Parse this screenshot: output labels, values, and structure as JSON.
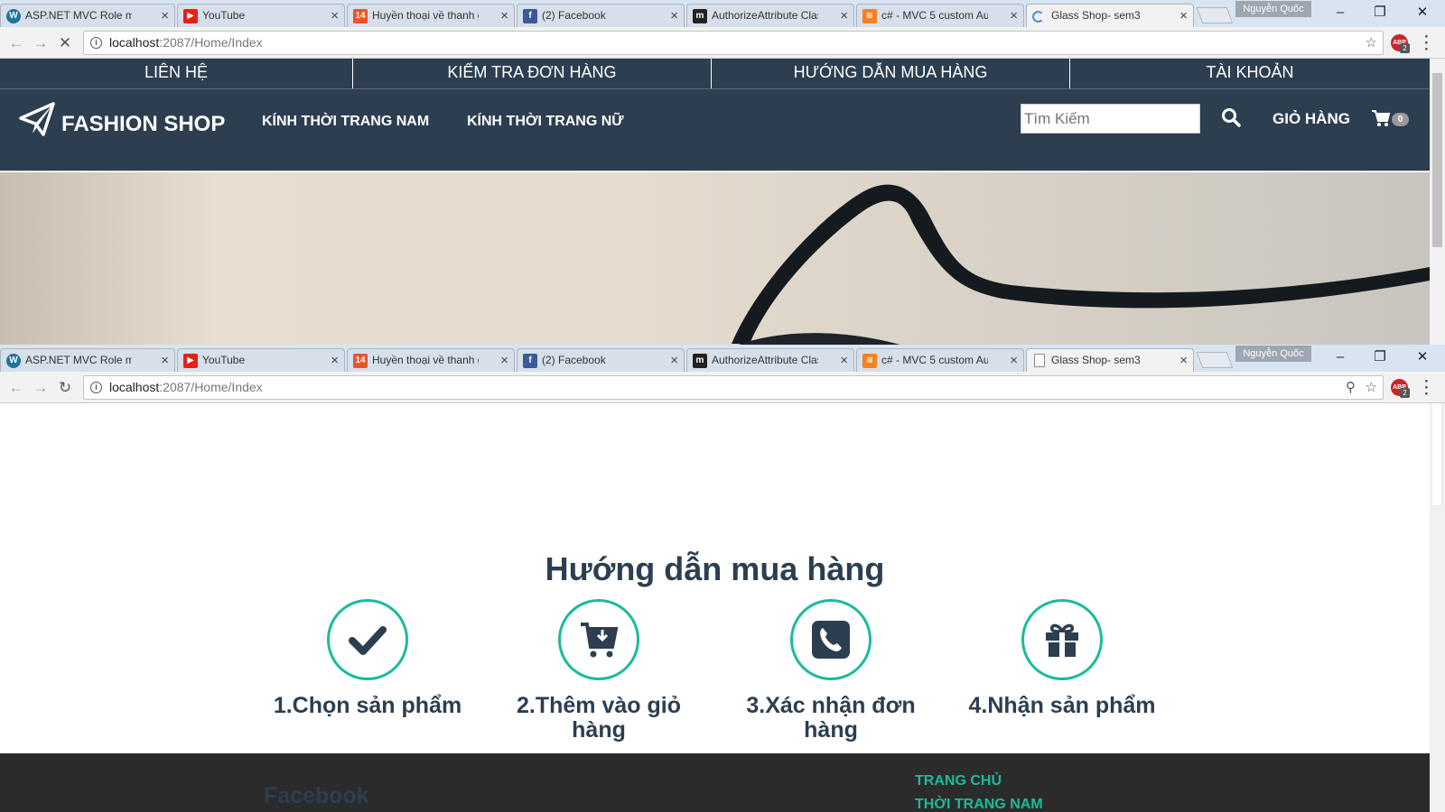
{
  "window_top": {
    "tabs": [
      {
        "label": "ASP.NET MVC Role mar",
        "icon": "wordpress-icon"
      },
      {
        "label": "YouTube",
        "icon": "youtube-icon"
      },
      {
        "label": "Huyền thoại về thanh g",
        "icon": "site-favicon-icon"
      },
      {
        "label": "(2) Facebook",
        "icon": "facebook-icon"
      },
      {
        "label": "AuthorizeAttribute Clas",
        "icon": "msdn-icon"
      },
      {
        "label": "c# - MVC 5 custom Aut",
        "icon": "stackoverflow-icon"
      },
      {
        "label": "Glass Shop- sem3",
        "icon": "loading-icon"
      }
    ],
    "profile": "Nguyễn Quốc",
    "url_host": "localhost",
    "url_path": ":2087/Home/Index"
  },
  "window_bottom": {
    "tabs": [
      {
        "label": "ASP.NET MVC Role mar",
        "icon": "wordpress-icon"
      },
      {
        "label": "YouTube",
        "icon": "youtube-icon"
      },
      {
        "label": "Huyền thoại về thanh g",
        "icon": "site-favicon-icon"
      },
      {
        "label": "(2) Facebook",
        "icon": "facebook-icon"
      },
      {
        "label": "AuthorizeAttribute Clas",
        "icon": "msdn-icon"
      },
      {
        "label": "c# - MVC 5 custom Aut",
        "icon": "stackoverflow-icon"
      },
      {
        "label": "Glass Shop- sem3",
        "icon": "page-icon"
      }
    ],
    "profile": "Nguyễn Quốc",
    "url_host": "localhost",
    "url_path": ":2087/Home/Index"
  },
  "site": {
    "topbar": [
      "LIÊN HỆ",
      "KIỂM TRA ĐƠN HÀNG",
      "HƯỚNG DẪN MUA HÀNG",
      "TÀI KHOẢN"
    ],
    "brand": "FASHION SHOP",
    "nav": [
      "KÍNH THỜI TRANG NAM",
      "KÍNH THỜI TRANG NỮ"
    ],
    "search_placeholder": "Tìm Kiếm",
    "cart_label": "GIỎ HÀNG",
    "cart_count": "0",
    "colors": {
      "navy": "#2c3e50",
      "teal": "#1abc9c",
      "footer": "#2b2b2b"
    }
  },
  "guide": {
    "title": "Hướng dẫn mua hàng",
    "steps": [
      {
        "label": "1.Chọn sản phẩm",
        "icon": "check-icon"
      },
      {
        "label": "2.Thêm vào giỏ hàng",
        "icon": "cart-download-icon"
      },
      {
        "label": "3.Xác nhận đơn hàng",
        "icon": "phone-icon"
      },
      {
        "label": "4.Nhận sản phẩm",
        "icon": "gift-icon"
      }
    ]
  },
  "footer": {
    "facebook_heading": "Facebook",
    "links": [
      "TRANG CHỦ",
      "THỜI TRANG NAM"
    ]
  }
}
